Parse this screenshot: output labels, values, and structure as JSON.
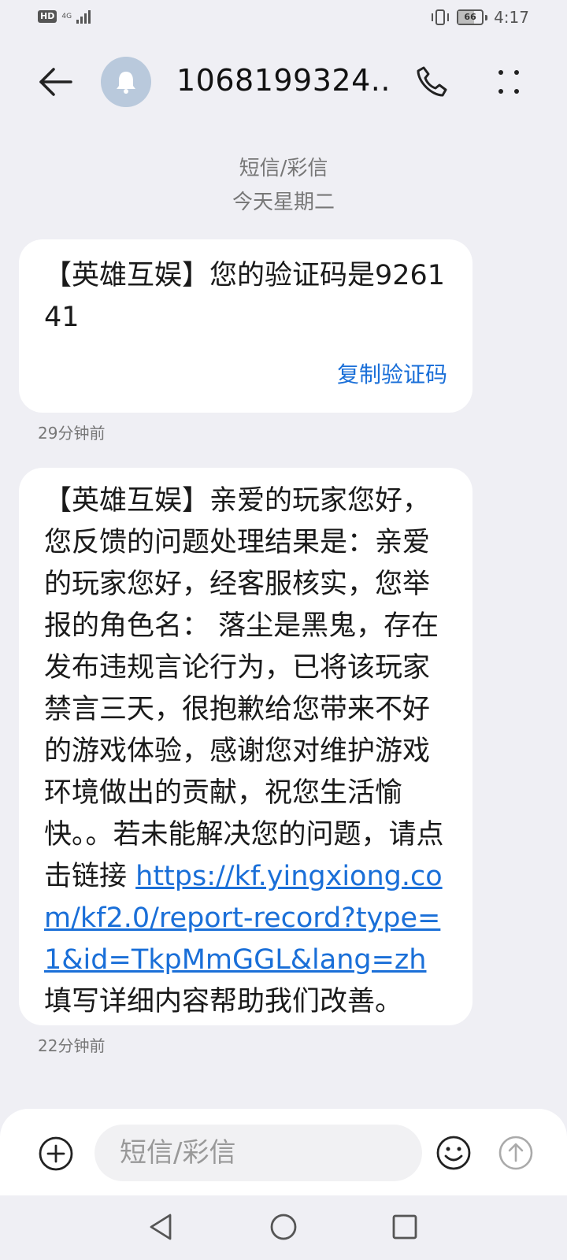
{
  "status_bar": {
    "hd_label": "HD",
    "network_label": "4G",
    "battery_level": "66",
    "battery_fraction": 0.66,
    "time": "4:17"
  },
  "header": {
    "contact_title": "1068199324...",
    "avatar_icon": "bell-icon",
    "back_icon": "arrow-left-icon",
    "call_icon": "phone-icon",
    "more_icon": "more-vertical-icon"
  },
  "conversation": {
    "category": "短信/彩信",
    "date": "今天星期二",
    "messages": [
      {
        "text": "【英雄互娱】您的验证码是926141",
        "action": "复制验证码",
        "time": "29分钟前"
      },
      {
        "text_before_link": "【英雄互娱】亲爱的玩家您好，您反馈的问题处理结果是：亲爱的玩家您好，经客服核实，您举报的角色名： 落尘是黑鬼，存在发布违规言论行为，已将该玩家禁言三天，很抱歉给您带来不好的游戏体验，感谢您对维护游戏环境做出的贡献，祝您生活愉快。。若未能解决您的问题，请点击链接 ",
        "link": "https://kf.yingxiong.com/kf2.0/report-record?type=1&id=TkpMmGGL&lang=zh",
        "text_after_link": "填写详细内容帮助我们改善。",
        "time": "22分钟前"
      }
    ]
  },
  "composer": {
    "placeholder": "短信/彩信",
    "value": "",
    "add_icon": "plus-circle-icon",
    "emoji_icon": "smiley-icon",
    "send_icon": "send-up-arrow-icon"
  },
  "navigation": {
    "back_icon": "triangle-back-icon",
    "home_icon": "circle-home-icon",
    "recent_icon": "square-recents-icon"
  },
  "colors": {
    "background": "#efeff4",
    "bubble": "#ffffff",
    "link": "#1a6fd8",
    "secondary_text": "#777777",
    "avatar": "#b9c9dc"
  }
}
